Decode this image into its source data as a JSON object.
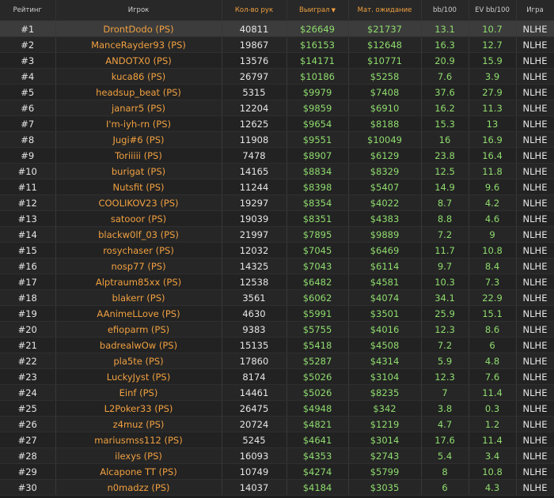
{
  "headers": {
    "rank": "Рейтинг",
    "player": "Игрок",
    "hands": "Кол-во рук",
    "winnings": "Выиграл",
    "ev": "Мат. ожидание",
    "bb100": "bb/100",
    "ev_bb100": "EV bb/100",
    "game": "Игра"
  },
  "sort": {
    "column": "winnings",
    "direction": "desc",
    "icon": "caret-down-icon"
  },
  "colors": {
    "header_bg": "#282828",
    "row_bg": "#222222",
    "row_alt_bg": "#262626",
    "highlight_row_bg": "#3c3c3c",
    "accent_orange": "#f0a040",
    "value_green": "#8fdc6e",
    "text": "#e6e6e6"
  },
  "rows": [
    {
      "rank": "#1",
      "player": "DrontDodo (PS)",
      "hands": "40811",
      "winnings": "$26649",
      "ev": "$21737",
      "bb100": "13.1",
      "ev_bb100": "10.7",
      "game": "NLHE"
    },
    {
      "rank": "#2",
      "player": "ManceRayder93 (PS)",
      "hands": "19867",
      "winnings": "$16153",
      "ev": "$12648",
      "bb100": "16.3",
      "ev_bb100": "12.7",
      "game": "NLHE"
    },
    {
      "rank": "#3",
      "player": "ANDOTX0 (PS)",
      "hands": "13576",
      "winnings": "$14171",
      "ev": "$10771",
      "bb100": "20.9",
      "ev_bb100": "15.9",
      "game": "NLHE"
    },
    {
      "rank": "#4",
      "player": "kuca86 (PS)",
      "hands": "26797",
      "winnings": "$10186",
      "ev": "$5258",
      "bb100": "7.6",
      "ev_bb100": "3.9",
      "game": "NLHE"
    },
    {
      "rank": "#5",
      "player": "headsup_beat (PS)",
      "hands": "5315",
      "winnings": "$9979",
      "ev": "$7408",
      "bb100": "37.6",
      "ev_bb100": "27.9",
      "game": "NLHE"
    },
    {
      "rank": "#6",
      "player": "janarr5 (PS)",
      "hands": "12204",
      "winnings": "$9859",
      "ev": "$6910",
      "bb100": "16.2",
      "ev_bb100": "11.3",
      "game": "NLHE"
    },
    {
      "rank": "#7",
      "player": "I'm-iyh-rn (PS)",
      "hands": "12625",
      "winnings": "$9654",
      "ev": "$8188",
      "bb100": "15.3",
      "ev_bb100": "13",
      "game": "NLHE"
    },
    {
      "rank": "#8",
      "player": "Jugi#6 (PS)",
      "hands": "11908",
      "winnings": "$9551",
      "ev": "$10049",
      "bb100": "16",
      "ev_bb100": "16.9",
      "game": "NLHE"
    },
    {
      "rank": "#9",
      "player": "Toriiiii (PS)",
      "hands": "7478",
      "winnings": "$8907",
      "ev": "$6129",
      "bb100": "23.8",
      "ev_bb100": "16.4",
      "game": "NLHE"
    },
    {
      "rank": "#10",
      "player": "burigat (PS)",
      "hands": "14165",
      "winnings": "$8834",
      "ev": "$8329",
      "bb100": "12.5",
      "ev_bb100": "11.8",
      "game": "NLHE"
    },
    {
      "rank": "#11",
      "player": "Nutsfit (PS)",
      "hands": "11244",
      "winnings": "$8398",
      "ev": "$5407",
      "bb100": "14.9",
      "ev_bb100": "9.6",
      "game": "NLHE"
    },
    {
      "rank": "#12",
      "player": "COOLIKOV23 (PS)",
      "hands": "19297",
      "winnings": "$8354",
      "ev": "$4022",
      "bb100": "8.7",
      "ev_bb100": "4.2",
      "game": "NLHE"
    },
    {
      "rank": "#13",
      "player": "satooor (PS)",
      "hands": "19039",
      "winnings": "$8351",
      "ev": "$4383",
      "bb100": "8.8",
      "ev_bb100": "4.6",
      "game": "NLHE"
    },
    {
      "rank": "#14",
      "player": "blackw0lf_03 (PS)",
      "hands": "21997",
      "winnings": "$7895",
      "ev": "$9889",
      "bb100": "7.2",
      "ev_bb100": "9",
      "game": "NLHE"
    },
    {
      "rank": "#15",
      "player": "rosychaser (PS)",
      "hands": "12032",
      "winnings": "$7045",
      "ev": "$6469",
      "bb100": "11.7",
      "ev_bb100": "10.8",
      "game": "NLHE"
    },
    {
      "rank": "#16",
      "player": "nosp77 (PS)",
      "hands": "14325",
      "winnings": "$7043",
      "ev": "$6114",
      "bb100": "9.7",
      "ev_bb100": "8.4",
      "game": "NLHE"
    },
    {
      "rank": "#17",
      "player": "Alptraum85xx (PS)",
      "hands": "12538",
      "winnings": "$6482",
      "ev": "$4581",
      "bb100": "10.3",
      "ev_bb100": "7.3",
      "game": "NLHE"
    },
    {
      "rank": "#18",
      "player": "blakerr (PS)",
      "hands": "3561",
      "winnings": "$6062",
      "ev": "$4074",
      "bb100": "34.1",
      "ev_bb100": "22.9",
      "game": "NLHE"
    },
    {
      "rank": "#19",
      "player": "AAnimeLLove (PS)",
      "hands": "4630",
      "winnings": "$5991",
      "ev": "$3501",
      "bb100": "25.9",
      "ev_bb100": "15.1",
      "game": "NLHE"
    },
    {
      "rank": "#20",
      "player": "efioparm (PS)",
      "hands": "9383",
      "winnings": "$5755",
      "ev": "$4016",
      "bb100": "12.3",
      "ev_bb100": "8.6",
      "game": "NLHE"
    },
    {
      "rank": "#21",
      "player": "badrealwOw (PS)",
      "hands": "15135",
      "winnings": "$5418",
      "ev": "$4508",
      "bb100": "7.2",
      "ev_bb100": "6",
      "game": "NLHE"
    },
    {
      "rank": "#22",
      "player": "pla5te (PS)",
      "hands": "17860",
      "winnings": "$5287",
      "ev": "$4314",
      "bb100": "5.9",
      "ev_bb100": "4.8",
      "game": "NLHE"
    },
    {
      "rank": "#23",
      "player": "LuckyJyst (PS)",
      "hands": "8174",
      "winnings": "$5026",
      "ev": "$3104",
      "bb100": "12.3",
      "ev_bb100": "7.6",
      "game": "NLHE"
    },
    {
      "rank": "#24",
      "player": "Einf (PS)",
      "hands": "14461",
      "winnings": "$5026",
      "ev": "$8235",
      "bb100": "7",
      "ev_bb100": "11.4",
      "game": "NLHE"
    },
    {
      "rank": "#25",
      "player": "L2Poker33 (PS)",
      "hands": "26475",
      "winnings": "$4948",
      "ev": "$342",
      "bb100": "3.8",
      "ev_bb100": "0.3",
      "game": "NLHE"
    },
    {
      "rank": "#26",
      "player": "z4muz (PS)",
      "hands": "20724",
      "winnings": "$4821",
      "ev": "$1219",
      "bb100": "4.7",
      "ev_bb100": "1.2",
      "game": "NLHE"
    },
    {
      "rank": "#27",
      "player": "mariusmss112 (PS)",
      "hands": "5245",
      "winnings": "$4641",
      "ev": "$3014",
      "bb100": "17.6",
      "ev_bb100": "11.4",
      "game": "NLHE"
    },
    {
      "rank": "#28",
      "player": "ilexys (PS)",
      "hands": "16093",
      "winnings": "$4353",
      "ev": "$2743",
      "bb100": "5.4",
      "ev_bb100": "3.4",
      "game": "NLHE"
    },
    {
      "rank": "#29",
      "player": "Alcapone TT (PS)",
      "hands": "10749",
      "winnings": "$4274",
      "ev": "$5799",
      "bb100": "8",
      "ev_bb100": "10.8",
      "game": "NLHE"
    },
    {
      "rank": "#30",
      "player": "n0madzz (PS)",
      "hands": "14037",
      "winnings": "$4184",
      "ev": "$3035",
      "bb100": "6",
      "ev_bb100": "4.3",
      "game": "NLHE"
    }
  ]
}
